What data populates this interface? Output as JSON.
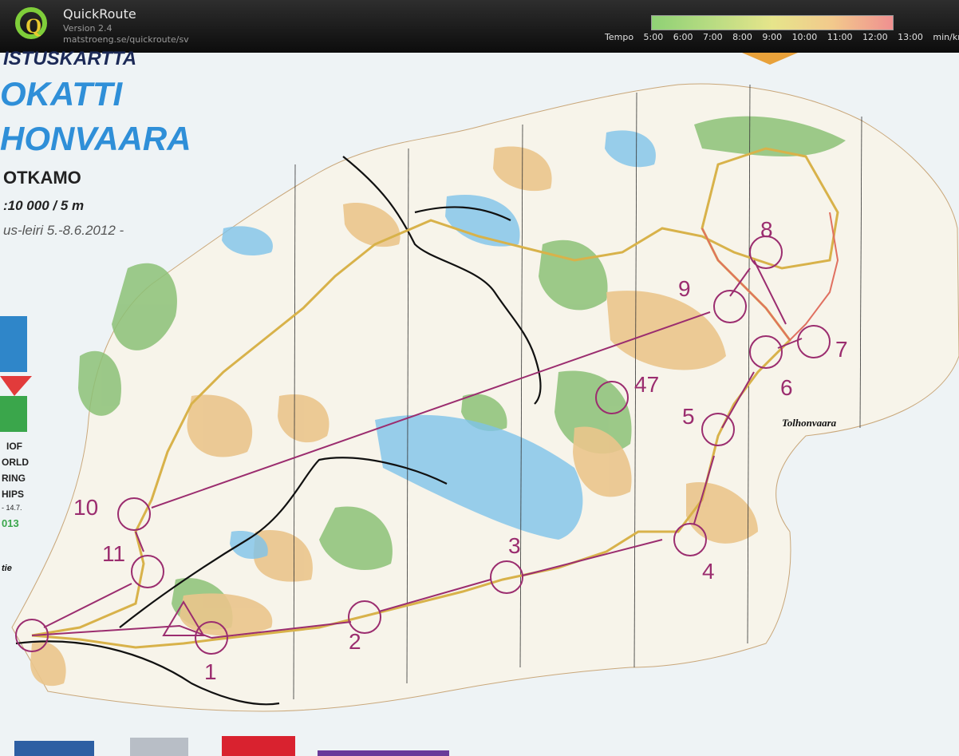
{
  "app": {
    "title": "QuickRoute",
    "version": "Version 2.4",
    "url": "matstroeng.se/quickroute/sv",
    "logo_icon": "quickroute-q-logo"
  },
  "tempo": {
    "label": "Tempo",
    "ticks": [
      "5:00",
      "6:00",
      "7:00",
      "8:00",
      "9:00",
      "10:00",
      "11:00",
      "12:00",
      "13:00"
    ],
    "unit": "min/km",
    "colors": [
      "#8fd175",
      "#b8dc82",
      "#e6e58b",
      "#f2c98c",
      "#f09090"
    ]
  },
  "map_header": {
    "line1": "ISTUSKARTTA",
    "line2": "OKATTI",
    "line3": "HONVAARA",
    "line4": "OTKAMO",
    "scale": ":10 000 / 5 m",
    "event": "us-leiri 5.-8.6.2012 -"
  },
  "sponsor_text": {
    "l1": "IOF",
    "l2": "ORLD",
    "l3": "RING",
    "l4": "HIPS",
    "l5": "- 14.7.",
    "l6": "013"
  },
  "place_names": {
    "tolhonvaara": "Tolhonvaara",
    "left_edge": "tie"
  },
  "controls": [
    "1",
    "2",
    "3",
    "4",
    "5",
    "6",
    "7",
    "8",
    "9",
    "10",
    "11"
  ],
  "extra_control": "47",
  "colors": {
    "course": "#9b2d6f",
    "route": "#d8b24a",
    "water": "#4fa9dc",
    "vegetation": "#7fb269",
    "open_land": "#e9c58a"
  }
}
